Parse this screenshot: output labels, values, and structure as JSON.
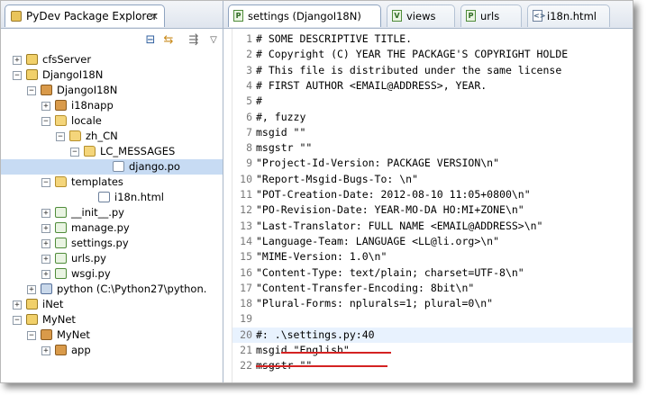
{
  "explorer": {
    "tab_title": "PyDev Package Explorer",
    "tab_close": "✕",
    "toolbar_icons": [
      "collapse-all-icon",
      "link-with-editor-icon",
      "view-menu-icon",
      "view-menu-arrow-icon"
    ],
    "tree": [
      {
        "label": "cfsServer",
        "icon": "project",
        "expander": "+",
        "selected": false
      },
      {
        "label": "DjangoI18N",
        "icon": "project",
        "expander": "−",
        "selected": false
      },
      {
        "label": "DjangoI18N",
        "icon": "package",
        "expander": "−",
        "selected": false
      },
      {
        "label": "i18napp",
        "icon": "package",
        "expander": "+",
        "selected": false
      },
      {
        "label": "locale",
        "icon": "folder",
        "expander": "−",
        "selected": false
      },
      {
        "label": "zh_CN",
        "icon": "folder",
        "expander": "−",
        "selected": false
      },
      {
        "label": "LC_MESSAGES",
        "icon": "folder",
        "expander": "−",
        "selected": false
      },
      {
        "label": "django.po",
        "icon": "file",
        "expander": "",
        "selected": true
      },
      {
        "label": "templates",
        "icon": "folder",
        "expander": "−",
        "selected": false
      },
      {
        "label": "i18n.html",
        "icon": "html",
        "expander": "",
        "selected": false
      },
      {
        "label": "__init__.py",
        "icon": "py",
        "expander": "+",
        "selected": false
      },
      {
        "label": "manage.py",
        "icon": "py",
        "expander": "+",
        "selected": false
      },
      {
        "label": "settings.py",
        "icon": "py",
        "expander": "+",
        "selected": false
      },
      {
        "label": "urls.py",
        "icon": "py",
        "expander": "+",
        "selected": false
      },
      {
        "label": "wsgi.py",
        "icon": "py",
        "expander": "+",
        "selected": false
      },
      {
        "label": "python  (C:\\Python27\\python.",
        "icon": "lib",
        "expander": "+",
        "selected": false
      },
      {
        "label": "iNet",
        "icon": "project",
        "expander": "+",
        "selected": false
      },
      {
        "label": "MyNet",
        "icon": "project",
        "expander": "−",
        "selected": false
      },
      {
        "label": "MyNet",
        "icon": "package",
        "expander": "−",
        "selected": false
      },
      {
        "label": "app",
        "icon": "package",
        "expander": "+",
        "selected": false
      }
    ]
  },
  "editor": {
    "tabs": [
      {
        "label": "settings (DjangoI18N)",
        "glyph": "P",
        "type": "py",
        "active": true
      },
      {
        "label": "views",
        "glyph": "V",
        "type": "py",
        "active": false
      },
      {
        "label": "urls",
        "glyph": "P",
        "type": "py",
        "active": false
      },
      {
        "label": "i18n.html",
        "glyph": "<>",
        "type": "html",
        "active": false
      }
    ],
    "lines": [
      {
        "num": "1",
        "text": "# SOME DESCRIPTIVE TITLE."
      },
      {
        "num": "2",
        "text": "# Copyright (C) YEAR THE PACKAGE'S COPYRIGHT HOLDE"
      },
      {
        "num": "3",
        "text": "# This file is distributed under the same license"
      },
      {
        "num": "4",
        "text": "# FIRST AUTHOR <EMAIL@ADDRESS>, YEAR."
      },
      {
        "num": "5",
        "text": "#"
      },
      {
        "num": "6",
        "text": "#, fuzzy"
      },
      {
        "num": "7",
        "text": "msgid \"\""
      },
      {
        "num": "8",
        "text": "msgstr \"\""
      },
      {
        "num": "9",
        "text": "\"Project-Id-Version: PACKAGE VERSION\\n\""
      },
      {
        "num": "10",
        "text": "\"Report-Msgid-Bugs-To: \\n\""
      },
      {
        "num": "11",
        "text": "\"POT-Creation-Date: 2012-08-10 11:05+0800\\n\""
      },
      {
        "num": "12",
        "text": "\"PO-Revision-Date: YEAR-MO-DA HO:MI+ZONE\\n\""
      },
      {
        "num": "13",
        "text": "\"Last-Translator: FULL NAME <EMAIL@ADDRESS>\\n\""
      },
      {
        "num": "14",
        "text": "\"Language-Team: LANGUAGE <LL@li.org>\\n\""
      },
      {
        "num": "15",
        "text": "\"MIME-Version: 1.0\\n\""
      },
      {
        "num": "16",
        "text": "\"Content-Type: text/plain; charset=UTF-8\\n\""
      },
      {
        "num": "17",
        "text": "\"Content-Transfer-Encoding: 8bit\\n\""
      },
      {
        "num": "18",
        "text": "\"Plural-Forms: nplurals=1; plural=0\\n\""
      },
      {
        "num": "19",
        "text": ""
      },
      {
        "num": "20",
        "text": "#: .\\settings.py:40"
      },
      {
        "num": "21",
        "text": "msgid \"English\""
      },
      {
        "num": "22",
        "text": "msgstr \"\""
      }
    ]
  },
  "colors": {
    "selection": "#c7dbf3",
    "current_line": "#e8f2fe",
    "annotation_red": "#d42222"
  }
}
